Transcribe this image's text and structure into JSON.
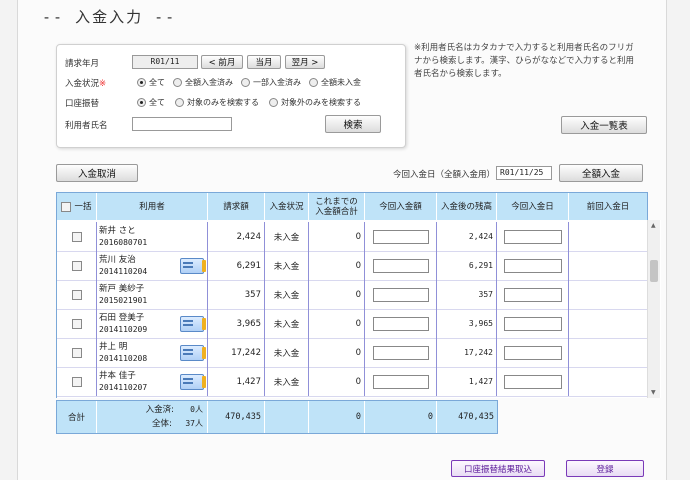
{
  "page_title": "-- 入金入力 --",
  "search": {
    "month_label": "請求年月",
    "month_value": "R01/11",
    "prev_month": "< 前月",
    "this_month": "当月",
    "next_month": "翌月 >",
    "status_label": "入金状況",
    "status_req": "※",
    "status_options": [
      "全て",
      "全額入金済み",
      "一部入金済み",
      "全額未入金"
    ],
    "status_selected": 0,
    "transfer_label": "口座振替",
    "transfer_options": [
      "全て",
      "対象のみを検索する",
      "対象外のみを検索する"
    ],
    "transfer_selected": 0,
    "user_label": "利用者氏名",
    "user_value": "",
    "search_button": "検索"
  },
  "note": "※利用者氏名はカタカナで入力すると利用者氏名のフリガナから検索します。漢字、ひらがななどで入力すると利用者氏名から検索します。",
  "list_button": "入金一覧表",
  "cancel_button": "入金取消",
  "date_label": "今回入金日（全額入金用）",
  "date_value": "R01/11/25",
  "full_button": "全額入金",
  "columns": [
    "一括",
    "利用者",
    "請求額",
    "入金状況",
    "これまでの入金額合計",
    "今回入金額",
    "入金後の残高",
    "今回入金日",
    "前回入金日"
  ],
  "rows": [
    {
      "name": "新井 さと",
      "id": "2016080701",
      "amount": "2,424",
      "status": "未入金",
      "paid": "0",
      "balance": "2,424",
      "card": false
    },
    {
      "name": "荒川 友治",
      "id": "2014110204",
      "amount": "6,291",
      "status": "未入金",
      "paid": "0",
      "balance": "6,291",
      "card": true
    },
    {
      "name": "新戸 美紗子",
      "id": "2015021901",
      "amount": "357",
      "status": "未入金",
      "paid": "0",
      "balance": "357",
      "card": false
    },
    {
      "name": "石田 登美子",
      "id": "2014110209",
      "amount": "3,965",
      "status": "未入金",
      "paid": "0",
      "balance": "3,965",
      "card": true
    },
    {
      "name": "井上 明",
      "id": "2014110208",
      "amount": "17,242",
      "status": "未入金",
      "paid": "0",
      "balance": "17,242",
      "card": true
    },
    {
      "name": "井本 佳子",
      "id": "2014110207",
      "amount": "1,427",
      "status": "未入金",
      "paid": "0",
      "balance": "1,427",
      "card": true
    }
  ],
  "footer": {
    "total_label": "合計",
    "paid_label": "入金済:",
    "paid_count": "0人",
    "all_label": "全体:",
    "all_count": "37人",
    "sum_amount": "470,435",
    "sum_paid": "0",
    "sum_current": "0",
    "sum_balance": "470,435"
  },
  "transfer_result_button": "口座振替結果取込",
  "register_button": "登録",
  "colors": {
    "header_bg": "#bfe3f8",
    "header_border": "#7aa8d8",
    "transfer_button_border": "#7a3ab8"
  }
}
